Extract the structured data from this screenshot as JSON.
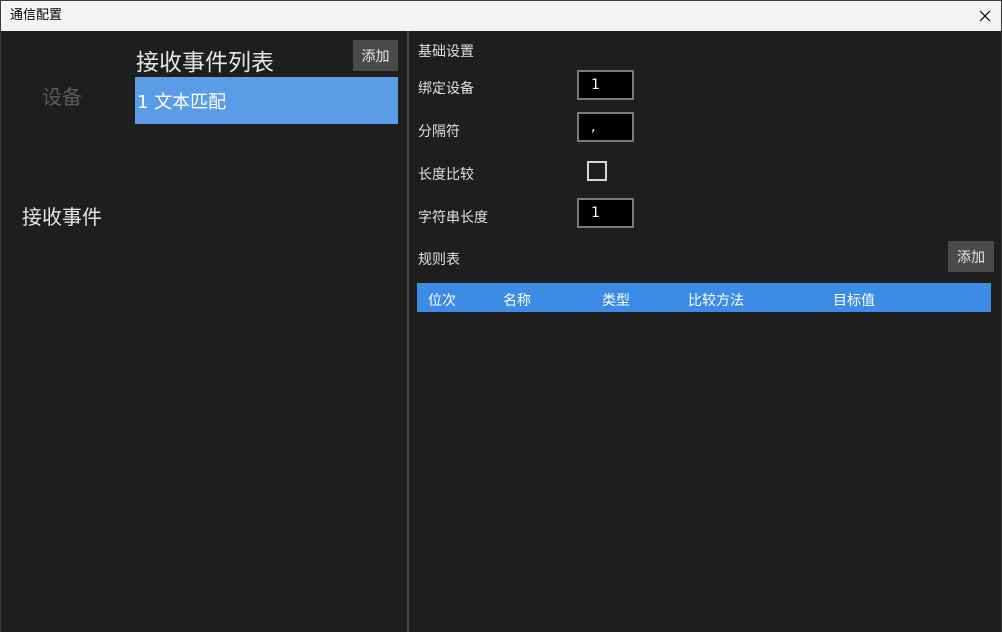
{
  "window": {
    "title": "通信配置"
  },
  "nav": {
    "device": "设备",
    "receive_event": "接收事件"
  },
  "event_list": {
    "title": "接收事件列表",
    "add_label": "添加",
    "items": [
      {
        "label": "1 文本匹配"
      }
    ]
  },
  "settings": {
    "section_title": "基础设置",
    "bind_device_label": "绑定设备",
    "bind_device_value": "1",
    "separator_label": "分隔符",
    "separator_value": ",",
    "length_compare_label": "长度比较",
    "length_compare_checked": false,
    "string_length_label": "字符串长度",
    "string_length_value": "1"
  },
  "rules": {
    "title": "规则表",
    "add_label": "添加",
    "columns": [
      "位次",
      "名称",
      "类型",
      "比较方法",
      "目标值"
    ],
    "rows": []
  },
  "colors": {
    "selected_item": "#5b9ce6",
    "table_header": "#3c8be5",
    "background": "#1e1e1e"
  }
}
